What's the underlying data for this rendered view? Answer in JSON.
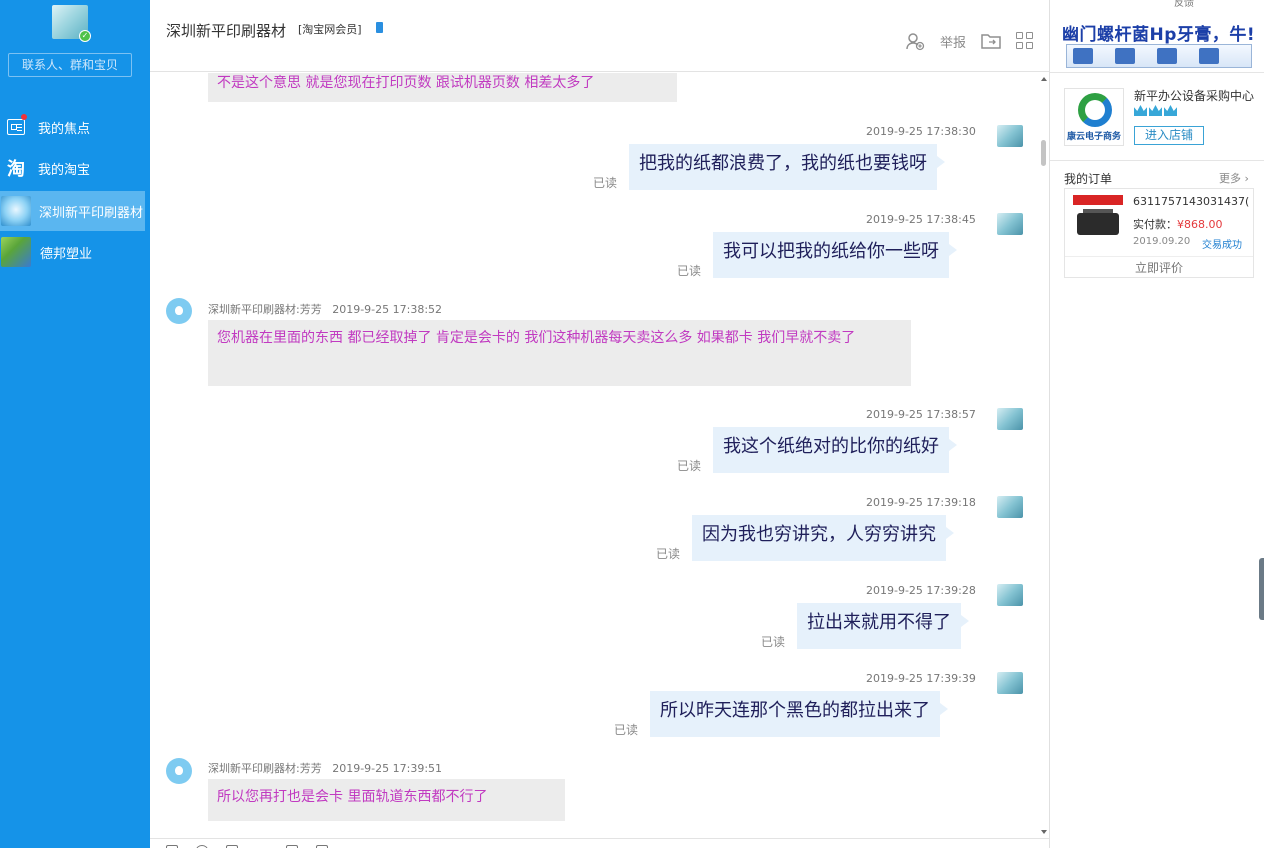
{
  "sidebar": {
    "search_placeholder": "联系人、群和宝贝",
    "items": [
      {
        "label": "我的焦点"
      },
      {
        "label": "我的淘宝",
        "icon_glyph": "淘"
      },
      {
        "label": "深圳新平印刷器材"
      },
      {
        "label": "德邦塑业"
      }
    ]
  },
  "chat": {
    "title": "深圳新平印刷器材",
    "badge": "[淘宝网会员]",
    "report_label": "举报",
    "read_label": "已读",
    "messages": [
      {
        "side": "left",
        "text": "不是这个意思  就是您现在打印页数  跟试机器页数  相差太多了"
      },
      {
        "side": "right",
        "time": "2019-9-25 17:38:30",
        "text": "把我的纸都浪费了，我的纸也要钱呀"
      },
      {
        "side": "right",
        "time": "2019-9-25 17:38:45",
        "text": "我可以把我的纸给你一些呀"
      },
      {
        "side": "left",
        "sender": "深圳新平印刷器材:芳芳",
        "time": "2019-9-25 17:38:52",
        "text": "您机器在里面的东西  都已经取掉了 肯定是会卡的  我们这种机器每天卖这么多  如果都卡  我们早就不卖了"
      },
      {
        "side": "right",
        "time": "2019-9-25 17:38:57",
        "text": "我这个纸绝对的比你的纸好"
      },
      {
        "side": "right",
        "time": "2019-9-25 17:39:18",
        "text": "因为我也穷讲究，人穷穷讲究"
      },
      {
        "side": "right",
        "time": "2019-9-25 17:39:28",
        "text": "拉出来就用不得了"
      },
      {
        "side": "right",
        "time": "2019-9-25 17:39:39",
        "text": "所以昨天连那个黑色的都拉出来了"
      },
      {
        "side": "left",
        "sender": "深圳新平印刷器材:芳芳",
        "time": "2019-9-25 17:39:51",
        "text": "所以您再打也是会卡  里面轨道东西都不行了"
      }
    ]
  },
  "right_panel": {
    "top_link": "反馈",
    "ad_text": "幽门螺杆菌Hp牙膏，牛!",
    "shop": {
      "logo_caption": "康云电子商务",
      "name": "新平办公设备采购中心",
      "enter_label": "进入店铺"
    },
    "orders": {
      "heading": "我的订单",
      "more_label": "更多",
      "order_id": "6311757143031437(",
      "paid_label": "实付款：",
      "paid_value": "¥868.00",
      "date": "2019.09.20",
      "status": "交易成功",
      "rate_label": "立即评价"
    }
  },
  "colors": {
    "sidebar_bg": "#1593e8",
    "sidebar_active": "#5ab6f0",
    "their_text": "#c13ac1",
    "my_bubble": "#e6f1fb",
    "their_bubble": "#ececec",
    "price_red": "#e4393c"
  }
}
